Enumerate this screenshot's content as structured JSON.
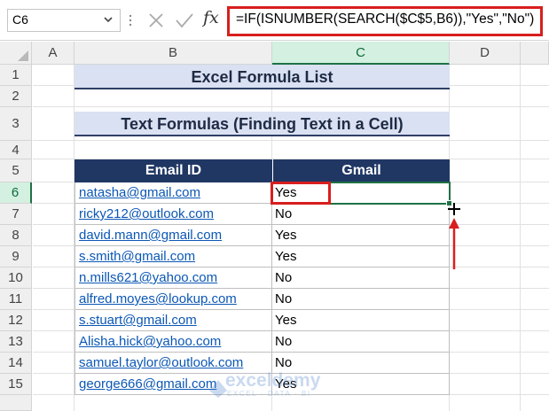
{
  "formula_bar": {
    "name_box": "C6",
    "formula": "=IF(ISNUMBER(SEARCH($C$5,B6)),\"Yes\",\"No\")",
    "fx_label": "fx",
    "icons": [
      "chevron-down-icon",
      "cancel-icon",
      "enter-icon",
      "fx-icon"
    ]
  },
  "columns": [
    "A",
    "B",
    "C",
    "D"
  ],
  "rows": [
    "1",
    "2",
    "3",
    "4",
    "5",
    "6",
    "7",
    "8",
    "9",
    "10",
    "11",
    "12",
    "13",
    "14",
    "15"
  ],
  "selected_cell": {
    "column": "C",
    "row": "6"
  },
  "sheet": {
    "title": "Excel Formula List",
    "subtitle": "Text Formulas (Finding Text in a Cell)",
    "table": {
      "headers": [
        "Email ID",
        "Gmail"
      ],
      "rows": [
        {
          "email": "natasha@gmail.com",
          "gmail": "Yes"
        },
        {
          "email": "ricky212@outlook.com",
          "gmail": "No"
        },
        {
          "email": "david.mann@gmail.com",
          "gmail": "Yes"
        },
        {
          "email": "s.smith@gmail.com",
          "gmail": "Yes"
        },
        {
          "email": "n.mills621@yahoo.com",
          "gmail": "No"
        },
        {
          "email": "alfred.moyes@lookup.com",
          "gmail": "No"
        },
        {
          "email": "s.stuart@gmail.com",
          "gmail": "Yes"
        },
        {
          "email": "Alisha.hick@yahoo.com",
          "gmail": "No"
        },
        {
          "email": "samuel.taylor@outlook.com",
          "gmail": "No"
        },
        {
          "email": "george666@gmail.com",
          "gmail": "Yes"
        }
      ]
    }
  },
  "watermark": {
    "title": "exceldemy",
    "subtitle": "EXCEL · DATA · BI"
  },
  "colors": {
    "header_fill": "#203764",
    "title_fill": "#d9e1f2",
    "selection": "#1e7145",
    "highlight": "#d81e1e",
    "link": "#0b57b5"
  }
}
